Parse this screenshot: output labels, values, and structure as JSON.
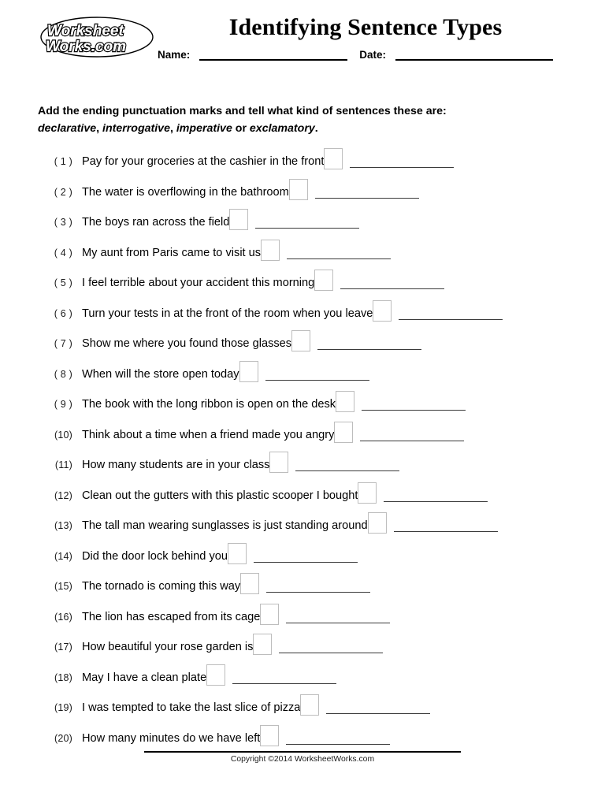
{
  "header": {
    "logo_line1": "Worksheet",
    "logo_line2": "Works.com",
    "logo_name": "worksheetworks-logo",
    "title": "Identifying Sentence Types",
    "name_label": "Name:",
    "date_label": "Date:",
    "name_value": "",
    "date_value": ""
  },
  "instructions": {
    "line1": "Add the ending punctuation marks and tell what kind of sentences these are:",
    "type1": "declarative",
    "sep1": ", ",
    "type2": "interrogative",
    "sep2": ", ",
    "type3": "imperative",
    "sep3": " or ",
    "type4": "exclamatory",
    "end": "."
  },
  "problems": [
    {
      "number": "( 1 )",
      "sentence": "Pay for your groceries at the cashier in the front",
      "punctuation": "",
      "answer": ""
    },
    {
      "number": "( 2 )",
      "sentence": "The water is overflowing in the bathroom",
      "punctuation": "",
      "answer": ""
    },
    {
      "number": "( 3 )",
      "sentence": "The boys ran across the field",
      "punctuation": "",
      "answer": ""
    },
    {
      "number": "( 4 )",
      "sentence": "My aunt from Paris came to visit us",
      "punctuation": "",
      "answer": ""
    },
    {
      "number": "( 5 )",
      "sentence": "I feel terrible about your accident this morning",
      "punctuation": "",
      "answer": ""
    },
    {
      "number": "( 6 )",
      "sentence": "Turn your tests in at the front of the room when you leave",
      "punctuation": "",
      "answer": ""
    },
    {
      "number": "( 7 )",
      "sentence": "Show me where you found those glasses",
      "punctuation": "",
      "answer": ""
    },
    {
      "number": "( 8 )",
      "sentence": "When will the store open today",
      "punctuation": "",
      "answer": ""
    },
    {
      "number": "( 9 )",
      "sentence": "The book with the long ribbon is open on the desk",
      "punctuation": "",
      "answer": ""
    },
    {
      "number": "(10)",
      "sentence": "Think about a time when a friend made you angry",
      "punctuation": "",
      "answer": ""
    },
    {
      "number": "(11)",
      "sentence": "How many students are in your class",
      "punctuation": "",
      "answer": ""
    },
    {
      "number": "(12)",
      "sentence": "Clean out the gutters with this plastic scooper I bought",
      "punctuation": "",
      "answer": ""
    },
    {
      "number": "(13)",
      "sentence": "The tall man wearing sunglasses is just standing around",
      "punctuation": "",
      "answer": ""
    },
    {
      "number": "(14)",
      "sentence": "Did the door lock behind you",
      "punctuation": "",
      "answer": ""
    },
    {
      "number": "(15)",
      "sentence": "The tornado is coming this way",
      "punctuation": "",
      "answer": ""
    },
    {
      "number": "(16)",
      "sentence": "The lion has escaped from its cage",
      "punctuation": "",
      "answer": ""
    },
    {
      "number": "(17)",
      "sentence": "How beautiful your rose garden is",
      "punctuation": "",
      "answer": ""
    },
    {
      "number": "(18)",
      "sentence": "May I have a clean plate",
      "punctuation": "",
      "answer": ""
    },
    {
      "number": "(19)",
      "sentence": "I was tempted to take the last slice of pizza",
      "punctuation": "",
      "answer": ""
    },
    {
      "number": "(20)",
      "sentence": "How many minutes do we have left",
      "punctuation": "",
      "answer": ""
    }
  ],
  "footer": {
    "copyright": "Copyright ©2014 WorksheetWorks.com"
  },
  "colors": {
    "ink": "#000000",
    "box_border": "#bdbdbd",
    "answer_rule": "#3a3a3a",
    "paper": "#ffffff"
  }
}
